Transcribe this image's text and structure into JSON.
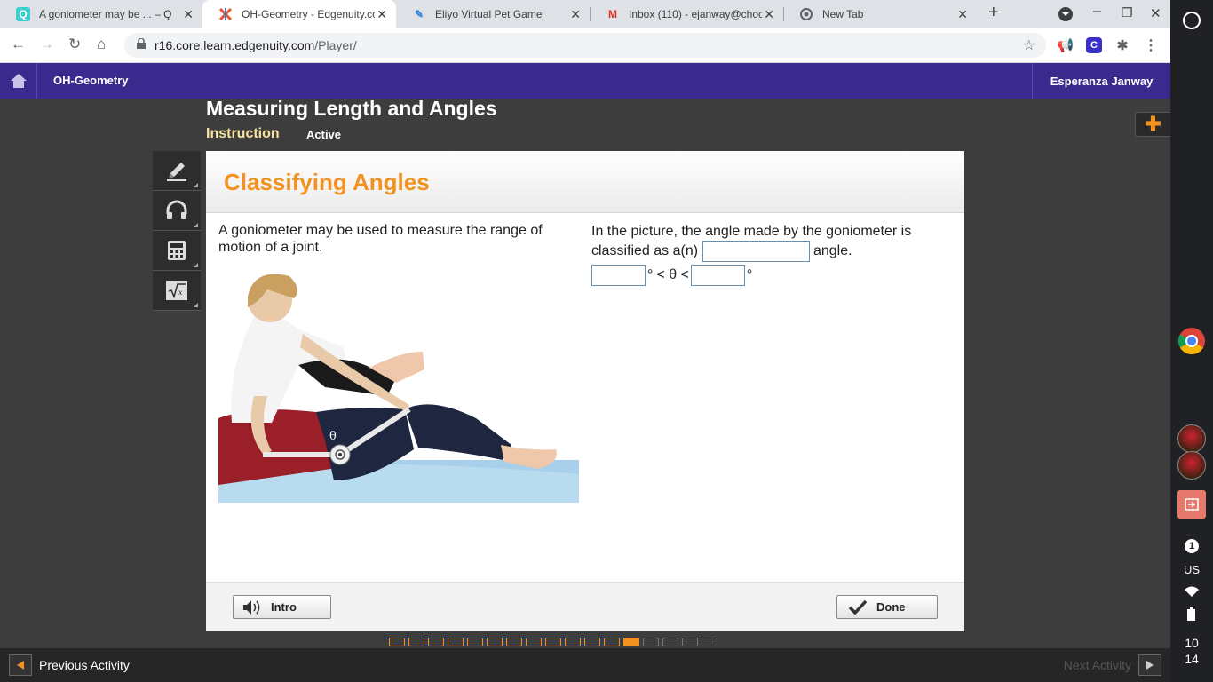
{
  "browser": {
    "tabs": [
      {
        "title": "A goniometer may be ... – Qu",
        "favicon": "quizlet-icon",
        "active": false
      },
      {
        "title": "OH-Geometry - Edgenuity.co",
        "favicon": "edgenuity-icon",
        "active": true
      },
      {
        "title": "Eliyo Virtual Pet Game",
        "favicon": "eliyo-icon",
        "active": false
      },
      {
        "title": "Inbox (110) - ejanway@choc",
        "favicon": "gmail-icon",
        "active": false
      },
      {
        "title": "New Tab",
        "favicon": "chrome-icon",
        "active": false
      }
    ],
    "url_host": "r16.core.learn.edgenuity.com",
    "url_path": "/Player/"
  },
  "header": {
    "course": "OH-Geometry",
    "user": "Esperanza Janway"
  },
  "lesson": {
    "title": "Measuring Length and Angles",
    "tab_instruction": "Instruction",
    "tab_active": "Active"
  },
  "content": {
    "title": "Classifying Angles",
    "left_text": "A goniometer may be used to measure the range of motion of a joint.",
    "photo_label": "θ",
    "question_pre": "In the picture, the angle made by the goniometer is classified as a(n)",
    "question_post": "angle.",
    "ineq_deg1": "°",
    "ineq_mid": "< θ <",
    "ineq_deg2": "°",
    "answers": {
      "classification": "",
      "lower": "",
      "upper": ""
    }
  },
  "footer": {
    "intro_label": "Intro",
    "done_label": "Done"
  },
  "progress": {
    "completed": 12,
    "current": 13,
    "total": 17
  },
  "bottom": {
    "prev_label": "Previous Activity",
    "next_label": "Next Activity"
  },
  "shelf": {
    "notification_count": "1",
    "locale": "US",
    "time_hour": "10",
    "time_min": "14"
  },
  "colors": {
    "brand_purple": "#3b2a8d",
    "accent_orange": "#f39220"
  }
}
